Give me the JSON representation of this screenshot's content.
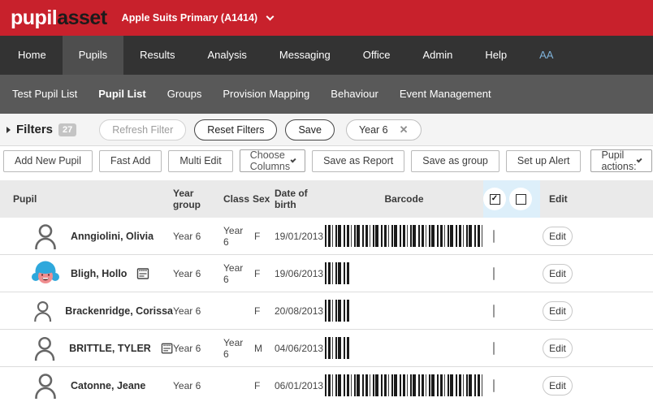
{
  "brand": {
    "logo_primary": "pupil",
    "logo_secondary": "asset",
    "school_selector": "Apple Suits Primary (A1414)"
  },
  "main_nav": {
    "items": [
      {
        "label": "Home",
        "active": false,
        "accent": false
      },
      {
        "label": "Pupils",
        "active": true,
        "accent": false
      },
      {
        "label": "Results",
        "active": false,
        "accent": false
      },
      {
        "label": "Analysis",
        "active": false,
        "accent": false
      },
      {
        "label": "Messaging",
        "active": false,
        "accent": false
      },
      {
        "label": "Office",
        "active": false,
        "accent": false
      },
      {
        "label": "Admin",
        "active": false,
        "accent": false
      },
      {
        "label": "Help",
        "active": false,
        "accent": false
      },
      {
        "label": "AA",
        "active": false,
        "accent": true
      }
    ]
  },
  "sub_nav": {
    "items": [
      {
        "label": "Test Pupil List",
        "active": false
      },
      {
        "label": "Pupil List",
        "active": true
      },
      {
        "label": "Groups",
        "active": false
      },
      {
        "label": "Provision Mapping",
        "active": false
      },
      {
        "label": "Behaviour",
        "active": false
      },
      {
        "label": "Event Management",
        "active": false
      }
    ]
  },
  "filters": {
    "title": "Filters",
    "count_badge": "27",
    "refresh_label": "Refresh Filter",
    "reset_label": "Reset Filters",
    "save_label": "Save",
    "filter_chip": "Year 6",
    "chip_close": "✕"
  },
  "toolbar": {
    "add_new_pupil": "Add New Pupil",
    "fast_add": "Fast Add",
    "multi_edit": "Multi Edit",
    "choose_columns": "Choose Columns",
    "save_as_report": "Save as Report",
    "save_as_group": "Save as group",
    "set_up_alert": "Set up Alert",
    "pupil_actions": "Pupil actions:"
  },
  "table": {
    "headers": {
      "pupil": "Pupil",
      "year_group": "Year group",
      "class": "Class",
      "sex": "Sex",
      "dob": "Date of birth",
      "barcode": "Barcode",
      "edit": "Edit"
    },
    "select_all_glyph": "✓",
    "edit_button_label": "Edit",
    "rows": [
      {
        "name": "Anngiolini, Olivia",
        "year_group": "Year 6",
        "class": "Year 6",
        "sex": "F",
        "dob": "19/01/2013",
        "barcode": "long",
        "avatar": "generic",
        "has_note": false,
        "checked": false
      },
      {
        "name": "Bligh, Hollo",
        "year_group": "Year 6",
        "class": "Year 6",
        "sex": "F",
        "dob": "19/06/2013",
        "barcode": "short",
        "avatar": "photo",
        "has_note": true,
        "checked": false
      },
      {
        "name": "Brackenridge, Corissa",
        "year_group": "Year 6",
        "class": "",
        "sex": "F",
        "dob": "20/08/2013",
        "barcode": "short",
        "avatar": "generic",
        "has_note": false,
        "checked": false
      },
      {
        "name": "BRITTLE, TYLER",
        "year_group": "Year 6",
        "class": "Year 6",
        "sex": "M",
        "dob": "04/06/2013",
        "barcode": "short",
        "avatar": "generic",
        "has_note": true,
        "checked": false
      },
      {
        "name": "Catonne, Jeane",
        "year_group": "Year 6",
        "class": "",
        "sex": "F",
        "dob": "06/01/2013",
        "barcode": "long",
        "avatar": "generic",
        "has_note": false,
        "checked": false
      }
    ]
  },
  "colors": {
    "brand_red": "#C8212C",
    "nav_dark": "#333333",
    "nav_active": "#4E4E4E",
    "subnav_gray": "#595959",
    "accent_blue": "#7FB2D9",
    "select_column_blue": "#DDEFFA",
    "filters_bg": "#F4F4F4"
  }
}
